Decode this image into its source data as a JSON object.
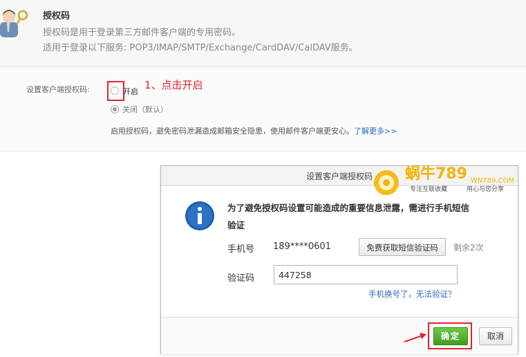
{
  "header": {
    "title": "授权码",
    "desc1": "授权码是用于登录第三方邮件客户端的专用密码。",
    "desc2": "适用于登录以下服务: POP3/IMAP/SMTP/Exchange/CardDAV/CalDAV服务。"
  },
  "settings": {
    "label": "设置客户端授权码:",
    "option_on": "开启",
    "option_off": "关闭（默认）",
    "selected": "关闭",
    "annotation": "1、点击开启",
    "tip": "启用授权码，避免密码泄漏造成邮箱安全隐患，使用邮件客户端更安心。",
    "learn_more": "了解更多>>"
  },
  "dialog": {
    "title": "设置客户端授权码",
    "watermark_text": "蜗牛789",
    "watermark_url": "WN789.COM",
    "watermark_slogan1": "专注互联收藏",
    "watermark_slogan2": "用心与您分享",
    "message_line1": "为了避免授权码设置可能造成的重要信息泄露，需进行手机短信",
    "message_line2": "验证",
    "phone_label": "手机号",
    "phone_value": "189****0601",
    "sms_button": "免费获取短信验证码",
    "remaining": "剩余2次",
    "code_label": "验证码",
    "code_value": "447258",
    "phone_changed_link": "手机换号了，无法验证？",
    "confirm": "确定",
    "cancel": "取消"
  },
  "colors": {
    "annotation_red": "#e0242e",
    "link_blue": "#2a6bc2",
    "confirm_green": "#4caf2b",
    "info_blue": "#1f5fa8"
  },
  "icons": {
    "user": "user-key-icon",
    "info": "info-icon",
    "arrow": "red-arrow-icon"
  }
}
